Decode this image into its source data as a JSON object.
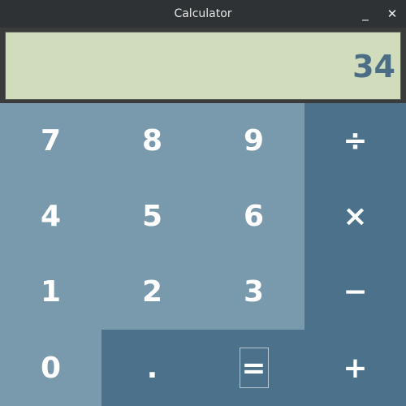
{
  "window": {
    "title": "Calculator",
    "minimize_label": "_",
    "close_label": "✕"
  },
  "display": {
    "value": "34"
  },
  "keys": {
    "seven": "7",
    "eight": "8",
    "nine": "9",
    "divide": "÷",
    "four": "4",
    "five": "5",
    "six": "6",
    "multiply": "×",
    "one": "1",
    "two": "2",
    "three": "3",
    "subtract": "−",
    "zero": "0",
    "decimal": ".",
    "equals": "=",
    "add": "+"
  },
  "colors": {
    "digit_key_bg": "#7999ad",
    "operator_key_bg": "#4c728b",
    "display_bg": "#d1dcbc",
    "display_text": "#4b6e86",
    "titlebar_bg": "#2e3234"
  }
}
